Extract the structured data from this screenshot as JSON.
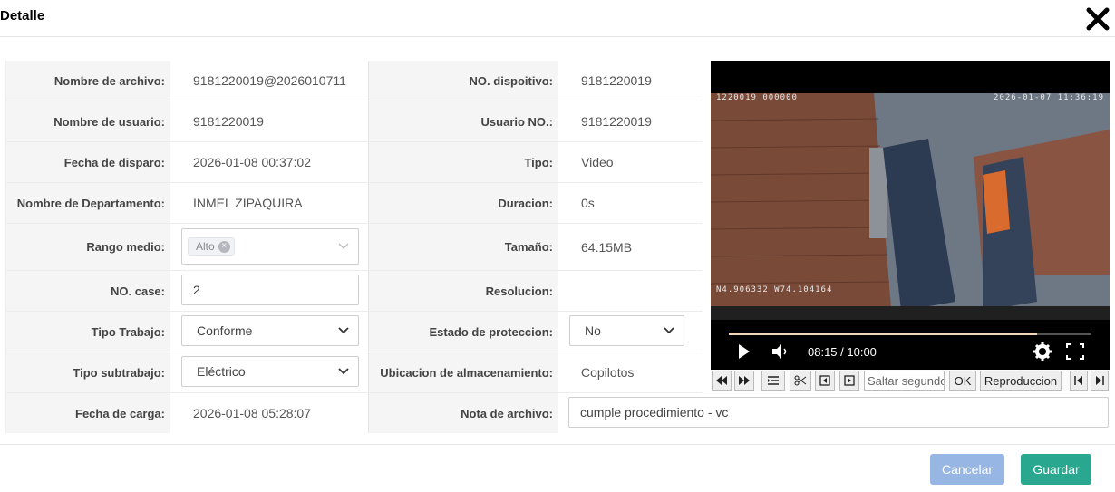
{
  "dialog": {
    "title": "Detalle"
  },
  "fields": {
    "file_name": {
      "label": "Nombre de archivo:",
      "value": "9181220019@2026010711"
    },
    "device_no": {
      "label": "NO. dispoitivo:",
      "value": "9181220019"
    },
    "user_name": {
      "label": "Nombre de usuario:",
      "value": "9181220019"
    },
    "user_no": {
      "label": "Usuario NO.:",
      "value": "9181220019"
    },
    "trigger_date": {
      "label": "Fecha de disparo:",
      "value": "2026-01-08 00:37:02"
    },
    "type": {
      "label": "Tipo:",
      "value": "Video"
    },
    "department": {
      "label": "Nombre de Departamento:",
      "value": "INMEL ZIPAQUIRA"
    },
    "duration": {
      "label": "Duracion:",
      "value": "0s"
    },
    "media_range": {
      "label": "Rango medio:",
      "tag": "Alto"
    },
    "size": {
      "label": "Tamaño:",
      "value": "64.15MB"
    },
    "case_no": {
      "label": "NO. case:",
      "value": "2"
    },
    "resolution": {
      "label": "Resolucion:",
      "value": ""
    },
    "work_type": {
      "label": "Tipo Trabajo:",
      "value": "Conforme"
    },
    "protection": {
      "label": "Estado de proteccion:",
      "value": "No"
    },
    "sub_work_type": {
      "label": "Tipo subtrabajo:",
      "value": "Eléctrico"
    },
    "storage": {
      "label": "Ubicacion de almacenamiento:",
      "value": "Copilotos"
    },
    "upload_date": {
      "label": "Fecha de carga:",
      "value": "2026-01-08 05:28:07"
    },
    "note": {
      "label": "Nota de archivo:",
      "value": "cumple procedimiento - vc"
    }
  },
  "video": {
    "osd_id": "1220019_000000",
    "osd_datetime": "2026-01-07 11:36:19",
    "osd_coords": "N4.906332  W74.104164",
    "time": "08:15 / 10:00",
    "progress": 0.85
  },
  "toolbar": {
    "seek_placeholder": "Saltar segundos",
    "ok_label": "OK",
    "playback_label": "Reproduccion"
  },
  "buttons": {
    "cancel": "Cancelar",
    "save": "Guardar"
  },
  "colors": {
    "primary": "#2aa88f",
    "cancel": "#97b6e3"
  }
}
